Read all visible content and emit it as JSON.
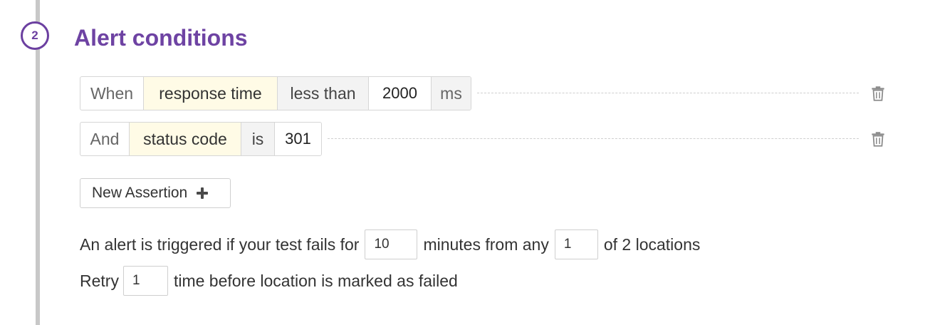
{
  "step": {
    "number": "2",
    "title": "Alert conditions"
  },
  "assertions": [
    {
      "connector": "When",
      "property": "response time",
      "operator": "less than",
      "value": "2000",
      "unit": "ms"
    },
    {
      "connector": "And",
      "property": "status code",
      "operator": "is",
      "value": "301"
    }
  ],
  "icons": {
    "delete": "trash-icon",
    "add": "plus-icon"
  },
  "new_assertion": {
    "label": "New Assertion"
  },
  "alert_rule": {
    "prefix": "An alert is triggered if your test fails for",
    "minutes_value": "10",
    "middle": "minutes from any",
    "locations_value": "1",
    "suffix": "of 2 locations"
  },
  "retry_rule": {
    "prefix": "Retry",
    "retry_value": "1",
    "suffix": "time before location is marked as failed"
  },
  "colors": {
    "accent": "#6e43a3",
    "property_highlight": "#fffbe6",
    "operator_bg": "#f3f3f3"
  }
}
